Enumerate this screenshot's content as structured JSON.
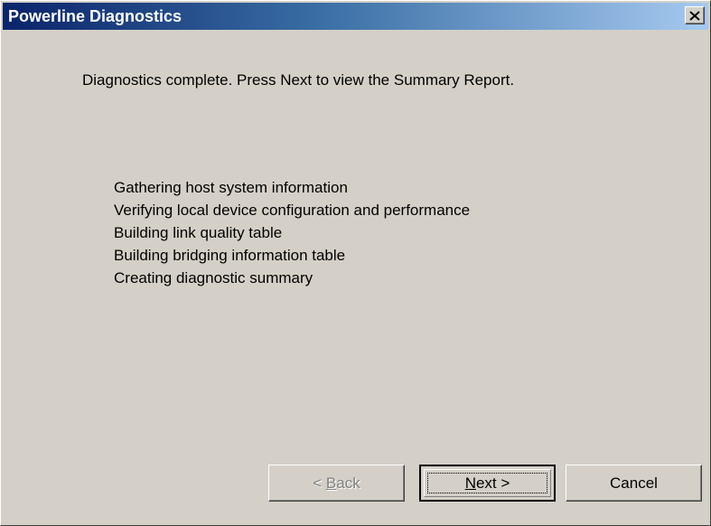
{
  "window": {
    "title": "Powerline Diagnostics"
  },
  "message": "Diagnostics complete. Press Next to view the Summary Report.",
  "steps": [
    "Gathering host system information",
    "Verifying local device configuration and performance",
    "Building link quality table",
    "Building bridging information table",
    "Creating diagnostic summary"
  ],
  "buttons": {
    "back": {
      "prefix": "< ",
      "accel": "B",
      "rest": "ack",
      "enabled": false
    },
    "next": {
      "prefix": "",
      "accel": "N",
      "rest": "ext >",
      "enabled": true
    },
    "cancel": {
      "label": "Cancel",
      "enabled": true
    }
  },
  "colors": {
    "title_gradient_start": "#0a246a",
    "title_gradient_end": "#a6caf0",
    "window_face": "#d4d0c8",
    "disabled_text": "#808080"
  },
  "icons": {
    "close": "close-icon"
  }
}
